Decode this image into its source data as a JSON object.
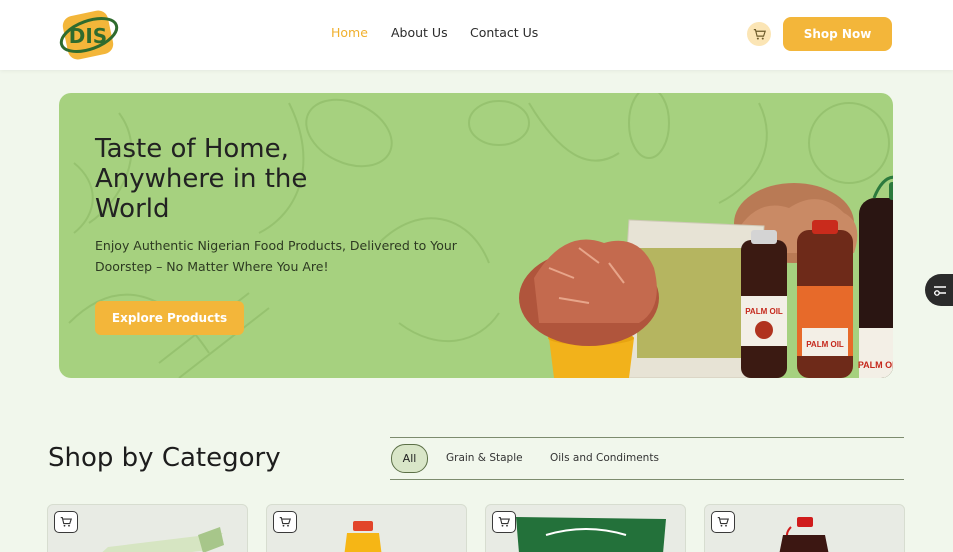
{
  "header": {
    "logo_text": "DIS",
    "nav": {
      "home": "Home",
      "about": "About Us",
      "contact": "Contact Us"
    },
    "cart_icon": "cart-icon",
    "shop_now": "Shop Now"
  },
  "hero": {
    "title": "Taste of Home, Anywhere in the World",
    "subtitle": "Enjoy Authentic Nigerian Food Products, Delivered to Your Doorstep – No Matter Where You Are!",
    "cta": "Explore Products",
    "product_labels": [
      "PALM OIL",
      "PALM OIL",
      "PALM OIL"
    ]
  },
  "categories": {
    "title": "Shop by Category",
    "filters": {
      "all": "All",
      "grain": "Grain & Staple",
      "oils": "Oils and Condiments"
    },
    "selected": "All"
  },
  "colors": {
    "accent": "#f3b63a",
    "hero_bg": "#a6d17f",
    "page_bg": "#f1f7ec",
    "logo_green": "#2f6b2e"
  }
}
